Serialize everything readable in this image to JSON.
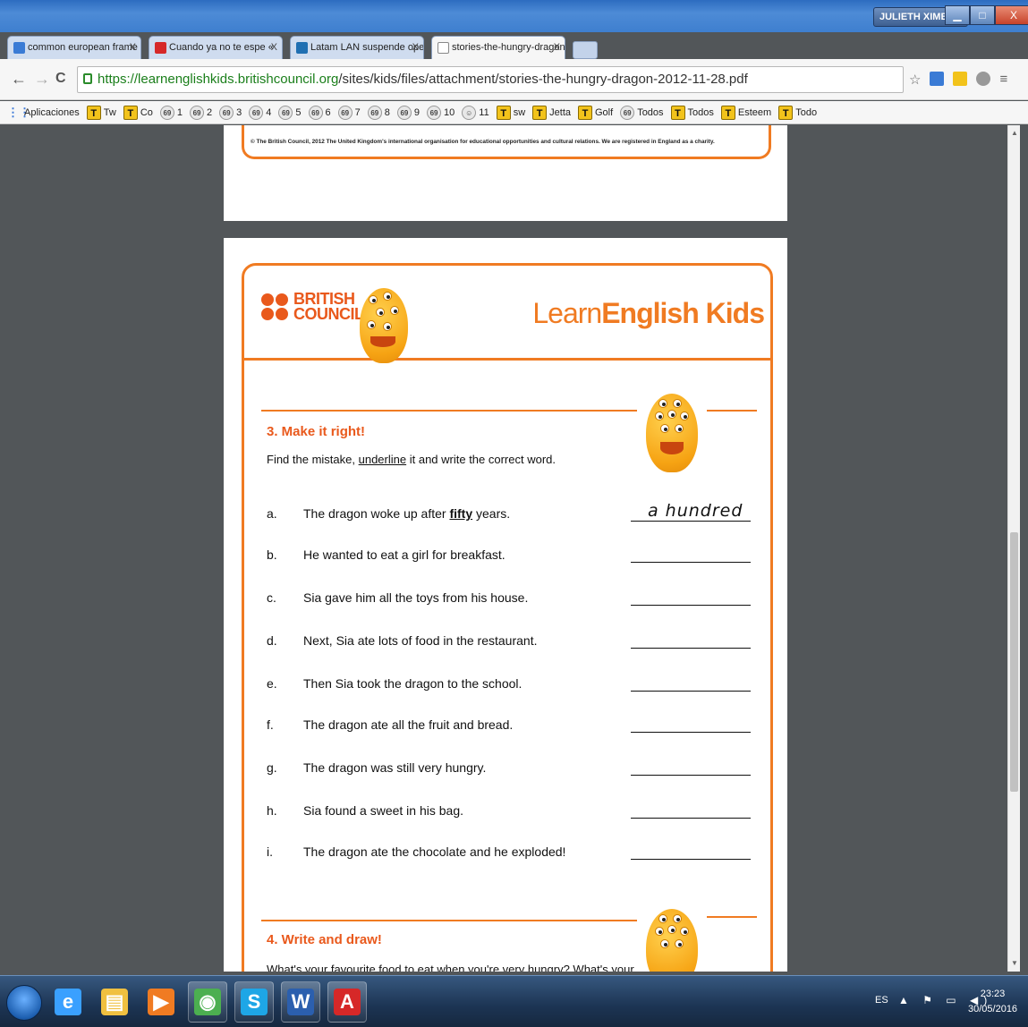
{
  "window": {
    "user_badge": "JULIETH XIMENA",
    "minimize": "▁",
    "maximize": "□",
    "close": "X"
  },
  "tabs": [
    {
      "label": "common european frame",
      "close": "X",
      "favicon_color": "#3a7bd5"
    },
    {
      "label": "Cuando ya no te espe «",
      "close": "X",
      "favicon_color": "#d62828"
    },
    {
      "label": "Latam LAN suspende ope",
      "close": "X",
      "favicon_color": "#1f6fb2"
    },
    {
      "label": "stories-the-hungry-dragon",
      "close": "X",
      "favicon_color": "#ffffff"
    }
  ],
  "toolbar": {
    "url_secure": "https://learnenglishkids.britishcouncil.org",
    "url_path": "/sites/kids/files/attachment/stories-the-hungry-dragon-2012-11-28.pdf",
    "back": "←",
    "forward": "→",
    "reload": "C",
    "star": "☆",
    "menu": "≡"
  },
  "bookmarks": [
    {
      "label": "Aplicaciones",
      "icon": "apps-icon",
      "glyph": "⋮⋮"
    },
    {
      "label": "Tw",
      "icon": "t-icon",
      "glyph": "T"
    },
    {
      "label": "Co",
      "icon": "t-icon",
      "glyph": "T"
    },
    {
      "label": "1",
      "icon": "o-icon",
      "glyph": "69"
    },
    {
      "label": "2",
      "icon": "o-icon",
      "glyph": "69"
    },
    {
      "label": "3",
      "icon": "o-icon",
      "glyph": "69"
    },
    {
      "label": "4",
      "icon": "o-icon",
      "glyph": "69"
    },
    {
      "label": "5",
      "icon": "o-icon",
      "glyph": "69"
    },
    {
      "label": "6",
      "icon": "o-icon",
      "glyph": "69"
    },
    {
      "label": "7",
      "icon": "o-icon",
      "glyph": "69"
    },
    {
      "label": "8",
      "icon": "o-icon",
      "glyph": "69"
    },
    {
      "label": "9",
      "icon": "o-icon",
      "glyph": "69"
    },
    {
      "label": "10",
      "icon": "o-icon",
      "glyph": "69"
    },
    {
      "label": "11",
      "icon": "o-icon",
      "glyph": "☺"
    },
    {
      "label": "sw",
      "icon": "t-icon",
      "glyph": "T"
    },
    {
      "label": "Jetta",
      "icon": "t-icon",
      "glyph": "T"
    },
    {
      "label": "Golf",
      "icon": "t-icon",
      "glyph": "T"
    },
    {
      "label": "Todos",
      "icon": "o-icon",
      "glyph": "69"
    },
    {
      "label": "Todos",
      "icon": "t-icon",
      "glyph": "T"
    },
    {
      "label": "Esteem",
      "icon": "t-icon",
      "glyph": "T"
    },
    {
      "label": "Todo",
      "icon": "t-icon",
      "glyph": "T"
    }
  ],
  "pdf": {
    "copyright": "© The British Council, 2012 The United Kingdom's international organisation for educational opportunities and cultural relations. We are registered in England as a charity.",
    "logo_line1": "BRITISH",
    "logo_line2": "COUNCIL",
    "brand_learn": "Learn",
    "brand_english": "English",
    "brand_kids": " Kids",
    "section3_title": "3. Make it right!",
    "section3_instr_before": "Find the mistake, ",
    "section3_instr_underlined": "underline",
    "section3_instr_after": " it and write the correct word.",
    "items": [
      {
        "letter": "a.",
        "text_before": "The dragon woke up after ",
        "mistake": "fifty",
        "text_after": " years.",
        "answer": "a hundred"
      },
      {
        "letter": "b.",
        "text": "He wanted to eat a girl for breakfast."
      },
      {
        "letter": "c.",
        "text": "Sia gave him all the toys from his house."
      },
      {
        "letter": "d.",
        "text": "Next, Sia ate lots of food in the restaurant."
      },
      {
        "letter": "e.",
        "text": "Then Sia took the dragon to the school."
      },
      {
        "letter": "f.",
        "text": "The dragon ate all the fruit and bread."
      },
      {
        "letter": "g.",
        "text": "The dragon was still very hungry."
      },
      {
        "letter": "h.",
        "text": "Sia found a sweet in his bag."
      },
      {
        "letter": "i.",
        "text": "The dragon ate the chocolate and he exploded!"
      }
    ],
    "section4_title": "4. Write and draw!",
    "section4_text": "What's your favourite food to eat when you're very hungry? What's your"
  },
  "taskbar": {
    "apps": [
      {
        "name": "internet-explorer-icon",
        "glyph": "e",
        "color": "#3aa0ff"
      },
      {
        "name": "file-explorer-icon",
        "glyph": "▤",
        "color": "#f0c040"
      },
      {
        "name": "media-player-icon",
        "glyph": "▶",
        "color": "#f07b22"
      },
      {
        "name": "chrome-icon",
        "glyph": "◉",
        "color": "#4caf50"
      },
      {
        "name": "skype-icon",
        "glyph": "S",
        "color": "#1ea6e6"
      },
      {
        "name": "word-icon",
        "glyph": "W",
        "color": "#2b5fae"
      },
      {
        "name": "acrobat-icon",
        "glyph": "A",
        "color": "#d62828"
      }
    ],
    "lang": "ES",
    "tray_icons": "▲ ⚑ ▭ ◀)",
    "time": "23:23",
    "date": "30/05/2016"
  },
  "colors": {
    "accent_orange": "#f07b22",
    "title_orange": "#e9591c"
  }
}
